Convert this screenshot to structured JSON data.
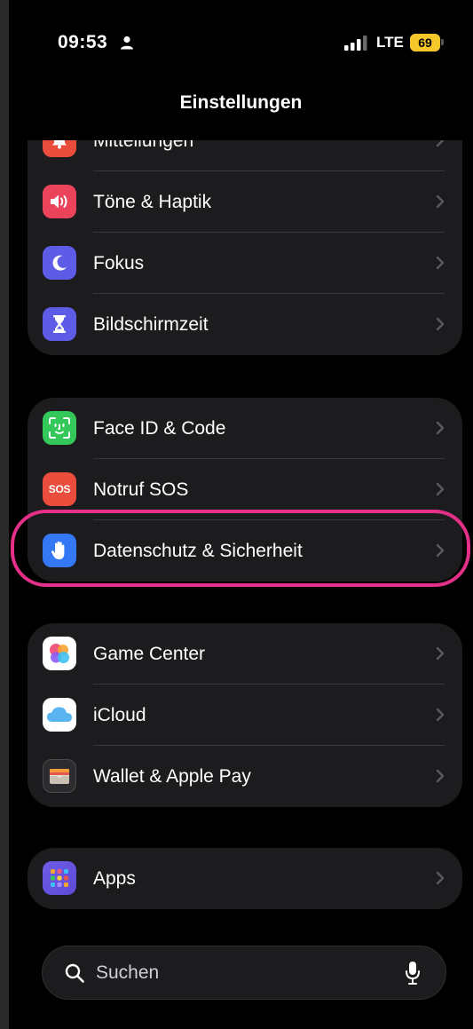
{
  "status_bar": {
    "time": "09:53",
    "network": "LTE",
    "battery": "69"
  },
  "nav": {
    "title": "Einstellungen"
  },
  "groups": [
    {
      "items": [
        {
          "label": "Mitteilungen",
          "icon": "bell-icon",
          "color": "#eb4d3d"
        },
        {
          "label": "Töne & Haptik",
          "icon": "speaker-icon",
          "color": "#eb445a"
        },
        {
          "label": "Fokus",
          "icon": "moon-icon",
          "color": "#5e5ce6"
        },
        {
          "label": "Bildschirmzeit",
          "icon": "hourglass-icon",
          "color": "#5e5ce6"
        }
      ]
    },
    {
      "items": [
        {
          "label": "Face ID & Code",
          "icon": "face-id-icon",
          "color": "#34c759"
        },
        {
          "label": "Notruf SOS",
          "icon": "sos-icon",
          "color": "#eb4d3d",
          "badge": "SOS"
        },
        {
          "label": "Datenschutz & Sicherheit",
          "icon": "hand-icon",
          "color": "#3478f6"
        }
      ]
    },
    {
      "items": [
        {
          "label": "Game Center",
          "icon": "game-center-icon",
          "color": "#ffffff"
        },
        {
          "label": "iCloud",
          "icon": "cloud-icon",
          "color": "#ffffff"
        },
        {
          "label": "Wallet & Apple Pay",
          "icon": "wallet-icon",
          "color": "#2c2c2e"
        }
      ]
    },
    {
      "items": [
        {
          "label": "Apps",
          "icon": "apps-grid-icon",
          "color": "#6e5ce6"
        }
      ]
    }
  ],
  "search": {
    "placeholder": "Suchen"
  },
  "highlight_color": "#e5308a"
}
